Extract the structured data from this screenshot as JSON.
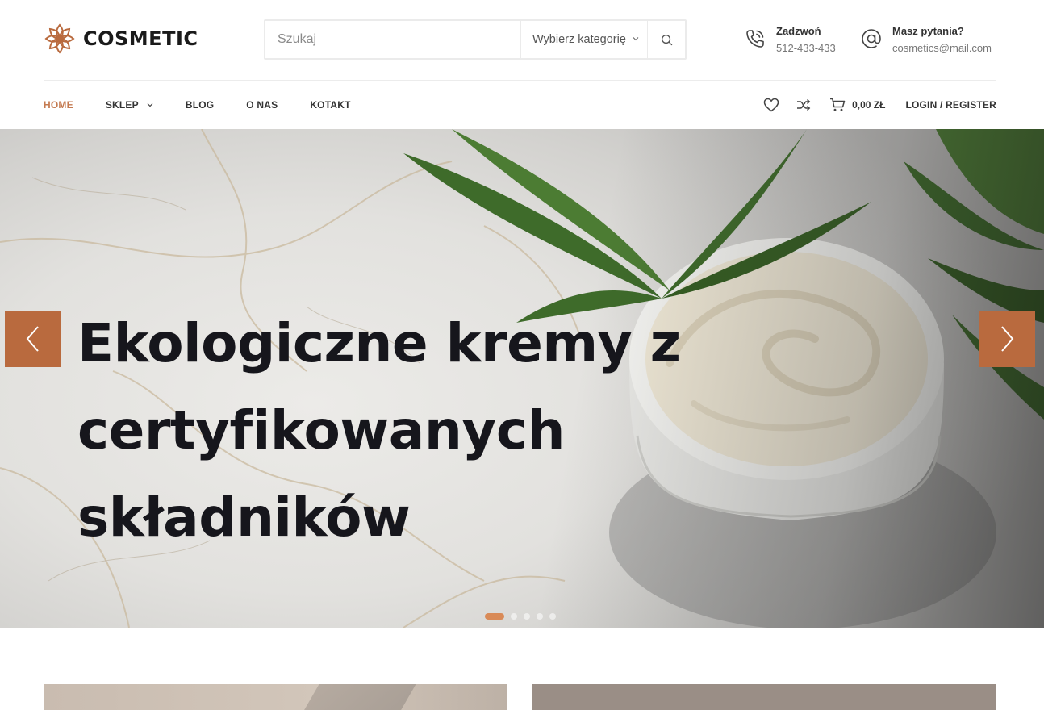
{
  "brand": {
    "name": "COSMETIC",
    "accent_color": "#c47a50",
    "button_color": "#b96a3e"
  },
  "search": {
    "placeholder": "Szukaj",
    "category_label": "Wybierz kategorię",
    "icon": "search-icon"
  },
  "contacts": {
    "phone": {
      "title": "Zadzwoń",
      "value": "512-433-433",
      "icon": "phone-icon"
    },
    "email": {
      "title": "Masz pytania?",
      "value": "cosmetics@mail.com",
      "icon": "at-icon"
    }
  },
  "nav": {
    "items": [
      {
        "label": "HOME",
        "active": true
      },
      {
        "label": "SKLEP",
        "has_dropdown": true
      },
      {
        "label": "BLOG"
      },
      {
        "label": "O NAS"
      },
      {
        "label": "KOTAKT"
      }
    ],
    "wishlist_icon": "heart-icon",
    "compare_icon": "shuffle-icon",
    "cart": {
      "icon": "cart-icon",
      "total": "0,00 ZŁ"
    },
    "login_label": "LOGIN / REGISTER"
  },
  "hero": {
    "title": "Ekologiczne kremy z certyfikowanych składników",
    "prev_icon": "chevron-left-icon",
    "next_icon": "chevron-right-icon",
    "slide_count": 5,
    "active_slide": 1
  }
}
